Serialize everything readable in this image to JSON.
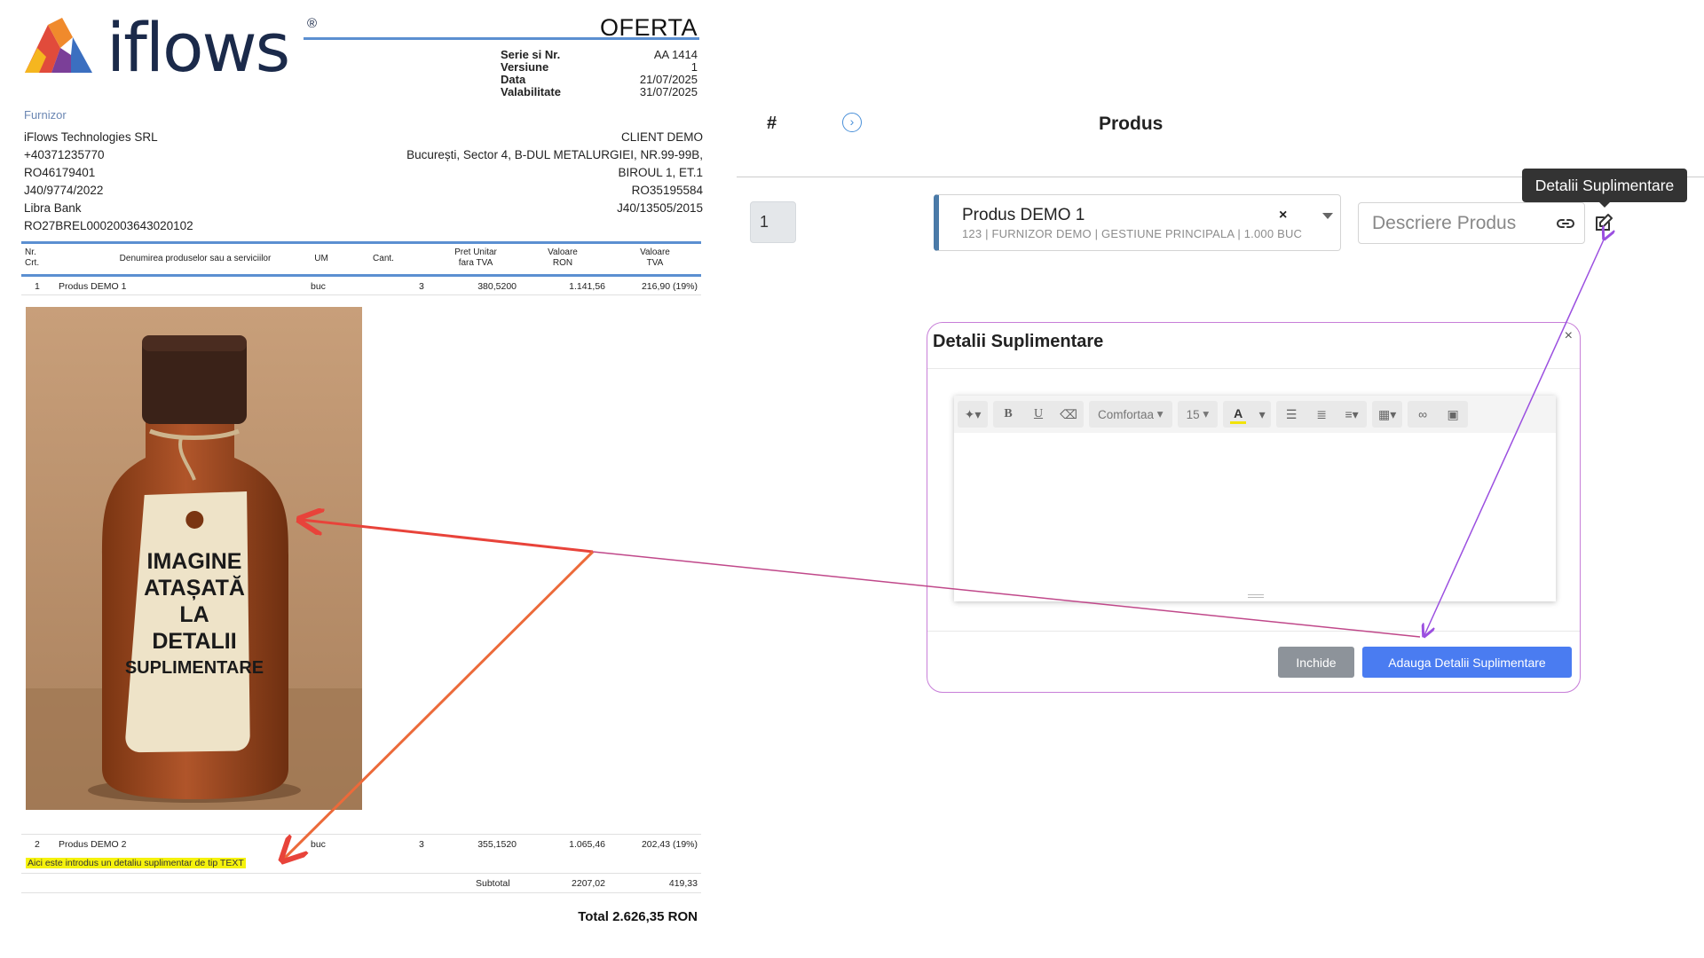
{
  "document": {
    "logo_text": "iflows",
    "logo_reg": "®",
    "title": "OFERTA",
    "meta": [
      {
        "label": "Serie si Nr.",
        "value": "AA 1414"
      },
      {
        "label": "Versiune",
        "value": "1"
      },
      {
        "label": "Data",
        "value": "21/07/2025"
      },
      {
        "label": "Valabilitate",
        "value": "31/07/2025"
      }
    ],
    "supplier_label": "Furnizor",
    "supplier": [
      "iFlows Technologies SRL",
      "+40371235770",
      "RO46179401",
      "J40/9774/2022",
      "Libra Bank",
      "RO27BREL0002003643020102"
    ],
    "client": [
      "CLIENT DEMO",
      "București, Sector 4, B-DUL METALURGIEI, NR.99-99B,",
      "BIROUL 1, ET.1",
      "RO35195584",
      "J40/13505/2015"
    ],
    "columns": [
      "Nr.\nCrt.",
      "Denumirea produselor sau a serviciilor",
      "UM",
      "Cant.",
      "Pret Unitar\nfara TVA",
      "Valoare\nRON",
      "Valoare\nTVA"
    ],
    "rows": [
      {
        "nr": "1",
        "name": "Produs DEMO 1",
        "um": "buc",
        "qty": "3",
        "price": "380,5200",
        "value": "1.141,56",
        "vat": "216,90 (19%)"
      },
      {
        "nr": "2",
        "name": "Produs DEMO 2",
        "um": "buc",
        "qty": "3",
        "price": "355,1520",
        "value": "1.065,46",
        "vat": "202,43 (19%)"
      }
    ],
    "image_tag_text": "IMAGINE ATAȘATĂ LA DETALII SUPLIMENTARE",
    "text_note": "Aici este introdus un detaliu suplimentar de tip TEXT",
    "subtotal": {
      "label": "Subtotal",
      "value": "2207,02",
      "vat": "419,33"
    },
    "total": "Total 2.626,35 RON"
  },
  "app": {
    "header": {
      "hash": "#",
      "product": "Produs"
    },
    "row_number": "1",
    "product_select": {
      "name": "Produs DEMO 1",
      "sub": "123 | FURNIZOR DEMO | GESTIUNE PRINCIPALA | 1.000 BUC",
      "clear": "×"
    },
    "description_placeholder": "Descriere Produs",
    "tooltip": "Detalii Suplimentare",
    "modal": {
      "title": "Detalii Suplimentare",
      "close": "×",
      "font_name": "Comfortaa",
      "font_size": "15",
      "btn_close": "Inchide",
      "btn_add": "Adauga Detalii Suplimentare"
    }
  },
  "colors": {
    "accent_blue": "#4a7cf1",
    "doc_line_blue": "#5b8fd1",
    "arrow_red": "#e8433a",
    "arrow_purple": "#9b4fe0",
    "highlight_yellow": "#f5f20c"
  }
}
